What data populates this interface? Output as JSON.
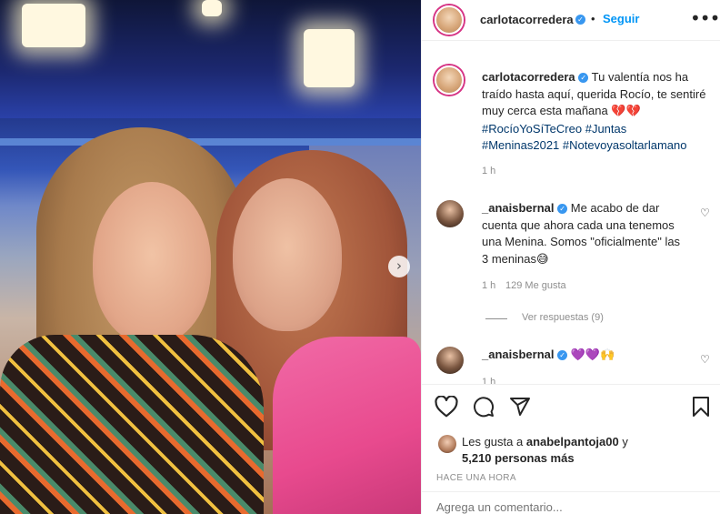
{
  "post": {
    "author": "carlotacorredera",
    "follow_label": "Seguir",
    "separator": "•",
    "more_label": "•••",
    "caption": {
      "username": "carlotacorredera",
      "text": "Tu valentía nos ha traído hasta aquí, querida Rocío, te sentiré muy cerca esta mañana",
      "emoji": "💔💔",
      "hashtags": [
        "#RocíoYoSíTeCreo",
        "#Juntas",
        "#Meninas2021",
        "#Notevoyasoltarlamano"
      ],
      "time": "1 h"
    },
    "comments": [
      {
        "username": "_anaisbernal",
        "text": "Me acabo de dar cuenta que ahora cada una tenemos una Menina. Somos \"oficialmente\" las 3 meninas",
        "emoji": "😅",
        "time": "1 h",
        "likes": "129 Me gusta",
        "view_replies": "Ver respuestas (9)"
      },
      {
        "username": "_anaisbernal",
        "emoji": "💜💜🙌",
        "time": "1 h"
      }
    ],
    "likes": {
      "prefix": "Les gusta a",
      "liker": "anabelpantoja00",
      "conj": "y",
      "others": "5,210 personas más"
    },
    "posted_ago": "HACE UNA HORA",
    "add_comment_placeholder": "Agrega un comentario..."
  },
  "icons": {
    "next": "chevron-right-icon",
    "like": "heart-icon",
    "comment": "comment-icon",
    "share": "send-icon",
    "save": "bookmark-icon",
    "verified": "verified-badge-icon"
  },
  "colors": {
    "link": "#0095f6",
    "hashtag": "#00376b",
    "muted": "#8e8e8e",
    "verified": "#3897f0"
  }
}
